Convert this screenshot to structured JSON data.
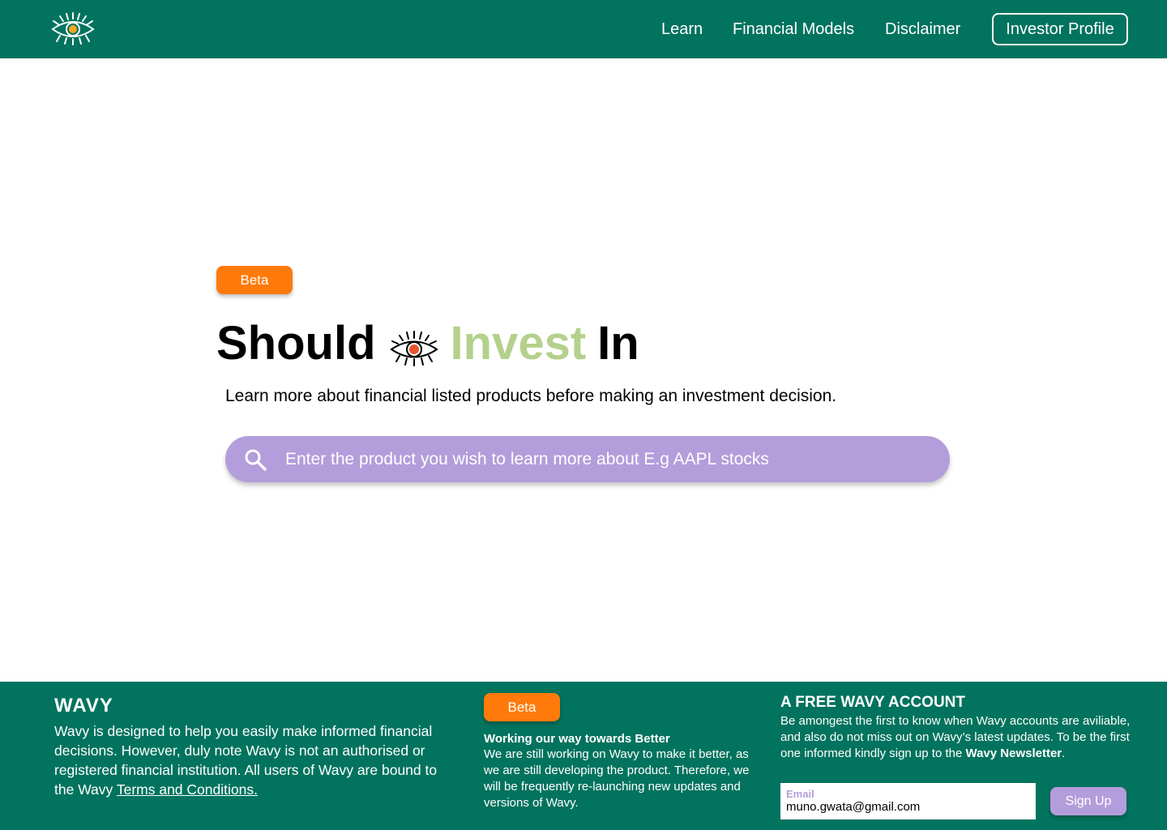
{
  "header": {
    "logo_icon": "eye-icon",
    "nav": {
      "learn": "Learn",
      "financial_models": "Financial Models",
      "disclaimer": "Disclaimer"
    },
    "profile_button": "Investor Profile"
  },
  "hero": {
    "badge": "Beta",
    "title_before": "Should",
    "title_icon": "eye-icon",
    "title_highlight": "Invest",
    "title_after": "In",
    "subtitle": "Learn more about financial listed products before making an investment decision.",
    "search": {
      "icon": "search-icon",
      "placeholder": "Enter the product you wish to learn more about E.g AAPL stocks"
    }
  },
  "footer": {
    "brand": "WAVY",
    "description": "Wavy is designed to help you easily make informed financial decisions. However, duly note Wavy is not an authorised or registered financial institution. All users of Wavy are bound to the Wavy ",
    "terms_link": "Terms and Conditions.",
    "badge": "Beta",
    "progress_title": "Working our way towards Better",
    "progress_text": "We are still working on Wavy to make it better, as we are still developing the product. Therefore, we will be frequently re-launching new updates and versions of Wavy.",
    "account_title": "A FREE WAVY ACCOUNT",
    "account_text": "Be amongest the first to know when Wavy accounts are aviliable, and also do not miss out on Wavy’s latest updates. To be the first one informed kindly sign up to the ",
    "account_text_bold": "Wavy Newsletter",
    "account_text_end": ".",
    "email_label": "Email",
    "email_value": "muno.gwata@gmail.com",
    "signup_button": "Sign Up"
  },
  "colors": {
    "brand_green": "#02735E",
    "accent_orange": "#FF7A0A",
    "accent_purple": "#B39DDB",
    "highlight_green": "#B4D18C"
  }
}
